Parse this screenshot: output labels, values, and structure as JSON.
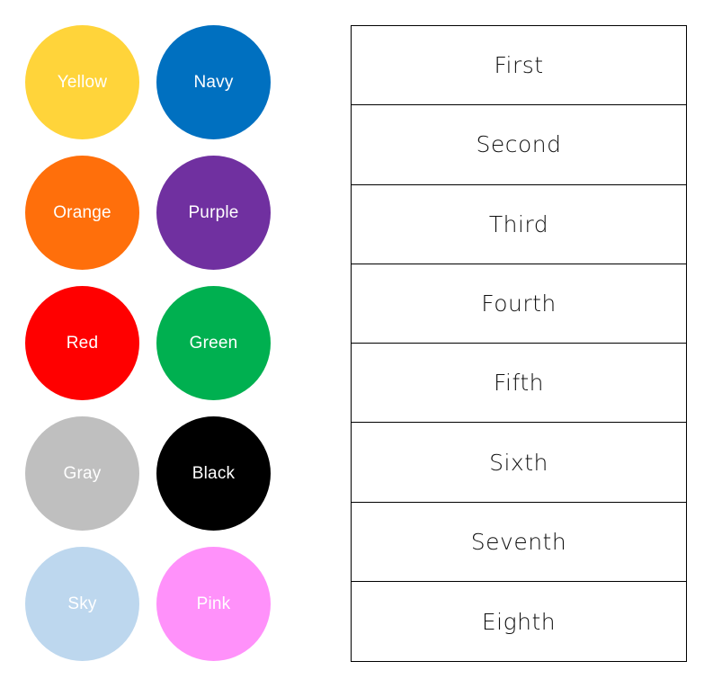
{
  "palette": {
    "swatches": [
      {
        "label": "Yellow",
        "color": "#FFD43A"
      },
      {
        "label": "Navy",
        "color": "#0070C0"
      },
      {
        "label": "Orange",
        "color": "#FF6F0B"
      },
      {
        "label": "Purple",
        "color": "#7030A0"
      },
      {
        "label": "Red",
        "color": "#FF0000"
      },
      {
        "label": "Green",
        "color": "#00B050"
      },
      {
        "label": "Gray",
        "color": "#BFBFBF"
      },
      {
        "label": "Black",
        "color": "#000000"
      },
      {
        "label": "Sky",
        "color": "#BDD7EE"
      },
      {
        "label": "Pink",
        "color": "#FF91FA"
      }
    ]
  },
  "ordinals": {
    "rows": [
      "First",
      "Second",
      "Third",
      "Fourth",
      "Fifth",
      "Sixth",
      "Seventh",
      "Eighth"
    ]
  }
}
